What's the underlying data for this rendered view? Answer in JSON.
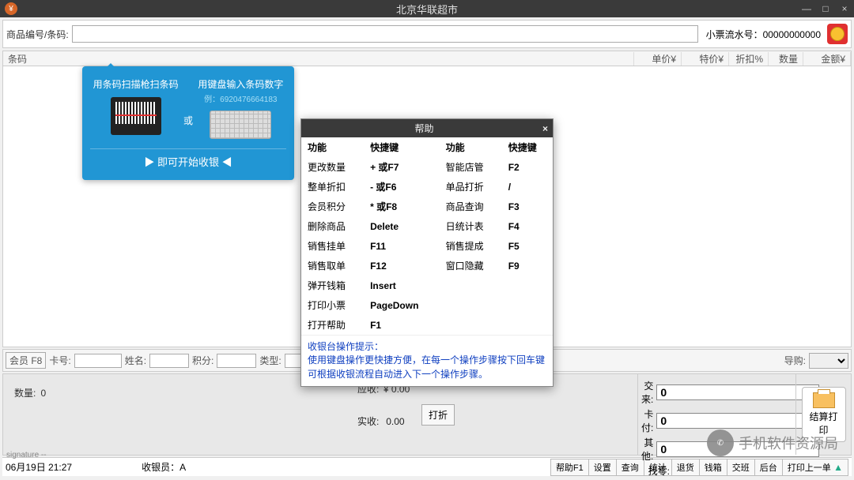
{
  "title": "北京华联超市",
  "barcode": {
    "label": "商品编号/条码:",
    "value": ""
  },
  "receipt": {
    "label": "小票流水号：",
    "value": "00000000000"
  },
  "columns": {
    "c1": "条码",
    "c2": "单价¥",
    "c3": "特价¥",
    "c4": "折扣%",
    "c5": "数量",
    "c6": "金额¥"
  },
  "tooltip": {
    "scan": "用条码扫描枪扫条码",
    "type": "用键盘输入条码数字",
    "example": "例：6920476664183",
    "or": "或",
    "start": "▶ 即可开始收银 ◀"
  },
  "help": {
    "title": "帮助",
    "h1": "功能",
    "h2": "快捷键",
    "h3": "功能",
    "h4": "快捷键",
    "rows": [
      {
        "f1": "更改数量",
        "k1": "+ 或F7",
        "f2": "智能店管",
        "k2": "F2"
      },
      {
        "f1": "整单折扣",
        "k1": "- 或F6",
        "f2": "单品打折",
        "k2": "/"
      },
      {
        "f1": "会员积分",
        "k1": "* 或F8",
        "f2": "商品查询",
        "k2": "F3"
      },
      {
        "f1": "删除商品",
        "k1": "Delete",
        "f2": "日统计表",
        "k2": "F4"
      },
      {
        "f1": "销售挂单",
        "k1": "F11",
        "f2": "销售提成",
        "k2": "F5"
      },
      {
        "f1": "销售取单",
        "k1": "F12",
        "f2": "窗口隐藏",
        "k2": "F9"
      },
      {
        "f1": "弹开钱箱",
        "k1": "Insert",
        "f2": "",
        "k2": ""
      },
      {
        "f1": "打印小票",
        "k1": "PageDown",
        "f2": "",
        "k2": ""
      },
      {
        "f1": "打开帮助",
        "k1": "F1",
        "f2": "",
        "k2": ""
      }
    ],
    "tips_head": "收银台操作提示：",
    "tips_body": "使用键盘操作更快捷方便，在每一个操作步骤按下回车键可根据收银流程自动进入下一个操作步骤。"
  },
  "member": {
    "btn": "会员 F8",
    "card": "卡号:",
    "name": "姓名:",
    "points": "积分:",
    "type": "类型:",
    "guide": "导购:"
  },
  "totals": {
    "qty_label": "数量:",
    "qty": "0",
    "due_label": "应收:",
    "due": "¥ 0.00",
    "paid_label": "实收:",
    "paid": "0.00",
    "discount_btn": "打折",
    "cash": "交来:",
    "cash_v": "0",
    "card": "卡付:",
    "card_v": "0",
    "other": "其他:",
    "other_v": "0",
    "change": "找零:",
    "print": "结算打印"
  },
  "status": {
    "date": "06月19日 21:27",
    "cashier_label": "收银员：",
    "cashier": "A",
    "btns": [
      "帮助F1",
      "设置",
      "查询",
      "统计",
      "退货",
      "钱箱",
      "交班",
      "后台",
      "打印上一单"
    ]
  },
  "sig": "signature --",
  "watermark": "手机软件资源局"
}
